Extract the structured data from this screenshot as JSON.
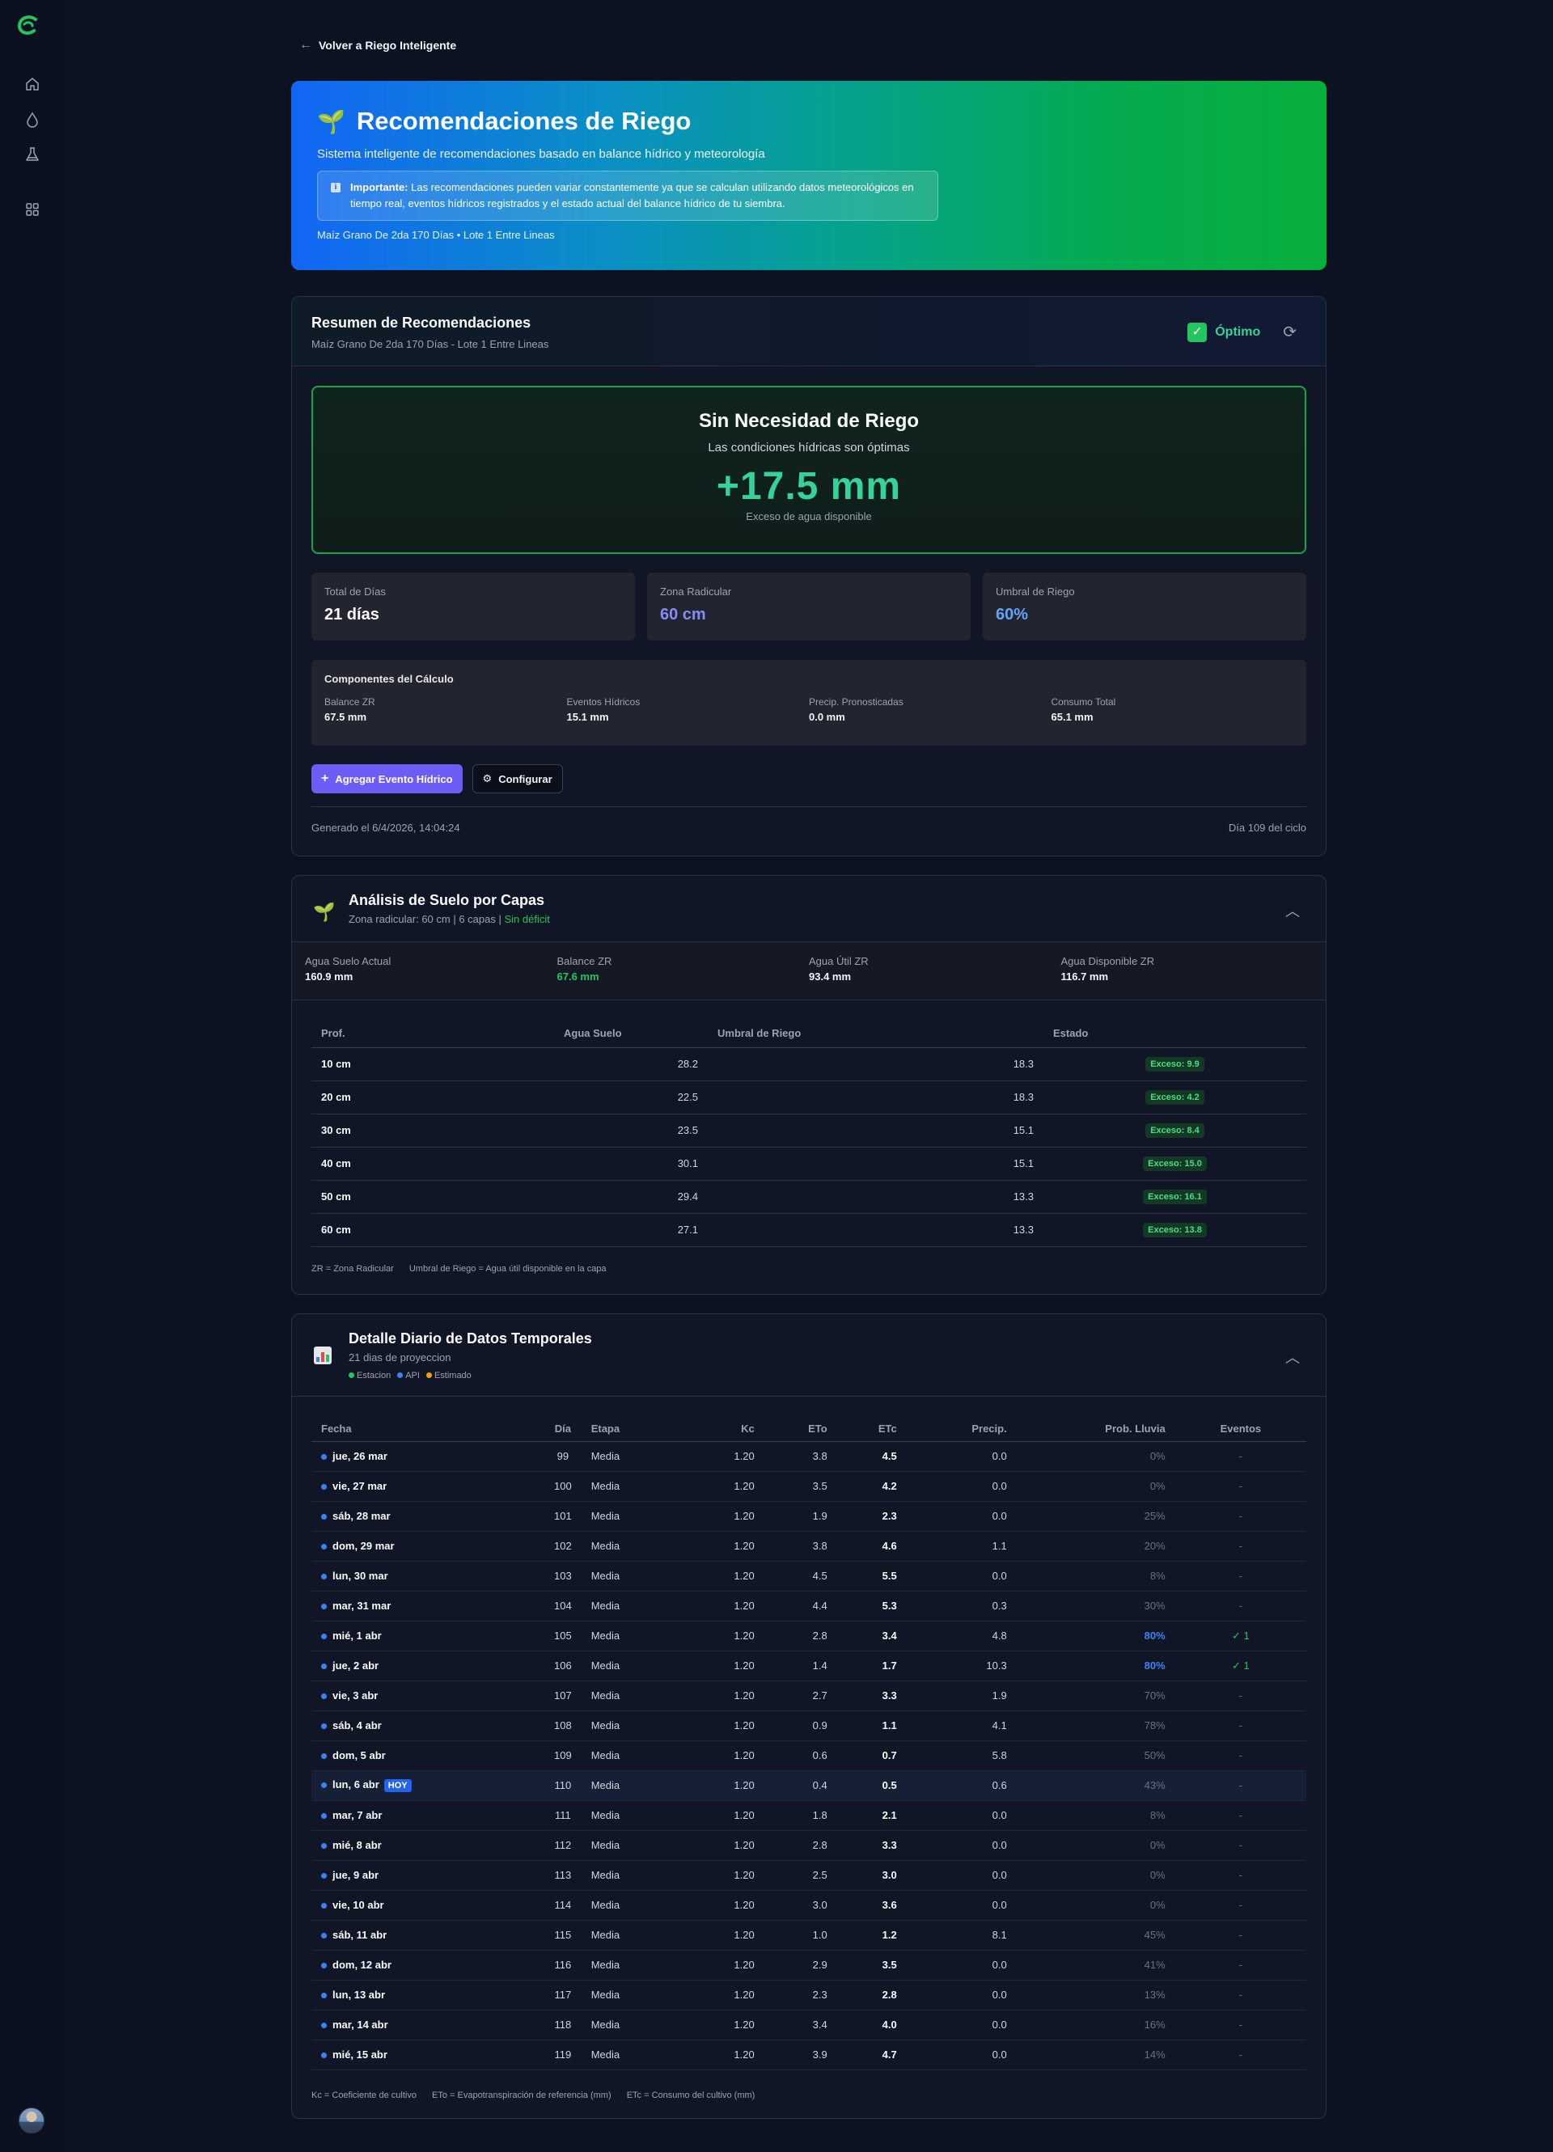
{
  "nav": {
    "back_label": "Volver a Riego Inteligente"
  },
  "hero": {
    "title": "Recomendaciones de Riego",
    "subtitle": "Sistema inteligente de recomendaciones basado en balance hídrico y meteorología",
    "note_bold": "Importante:",
    "note_text": " Las recomendaciones pueden variar constantemente ya que se calculan utilizando datos meteorológicos en tiempo real, eventos hídricos registrados y el estado actual del balance hídrico de tu siembra.",
    "crop": "Maíz Grano De 2da 170 Días • Lote 1 Entre Lineas"
  },
  "summary": {
    "title": "Resumen de Recomendaciones",
    "subtitle": "Maíz Grano De 2da 170 Días - Lote 1 Entre Lineas",
    "status": "Óptimo",
    "result_title": "Sin Necesidad de Riego",
    "result_sub": "Las condiciones hídricas son óptimas",
    "result_value": "+17.5 mm",
    "result_caption": "Exceso de agua disponible",
    "stats": [
      {
        "label": "Total de Días",
        "value": "21 días",
        "color": "#f8fafc"
      },
      {
        "label": "Zona Radicular",
        "value": "60 cm",
        "color": "#818cf8"
      },
      {
        "label": "Umbral de Riego",
        "value": "60%",
        "color": "#60a5fa"
      }
    ],
    "calc_title": "Componentes del Cálculo",
    "calc": [
      {
        "label": "Balance ZR",
        "value": "67.5 mm"
      },
      {
        "label": "Eventos Hídricos",
        "value": "15.1 mm"
      },
      {
        "label": "Precip. Pronosticadas",
        "value": "0.0 mm"
      },
      {
        "label": "Consumo Total",
        "value": "65.1 mm"
      }
    ],
    "add_button": "Agregar Evento Hídrico",
    "config_button": "Configurar",
    "generated": "Generado el 6/4/2026, 14:04:24",
    "cycle_day": "Día 109 del ciclo"
  },
  "soil": {
    "title": "Análisis de Suelo por Capas",
    "subtitle": "Zona radicular: 60 cm | 6 capas |",
    "subtitle_status": "Sin déficit",
    "metrics": [
      {
        "label": "Agua Suelo Actual",
        "value": "160.9 mm",
        "color": "#f1f5f9"
      },
      {
        "label": "Balance ZR",
        "value": "67.6 mm",
        "color": "#22c55e"
      },
      {
        "label": "Agua Útil ZR",
        "value": "93.4 mm",
        "color": "#f1f5f9"
      },
      {
        "label": "Agua Disponible ZR",
        "value": "116.7 mm",
        "color": "#f1f5f9"
      }
    ],
    "columns": [
      "Prof.",
      "Agua Suelo",
      "Umbral de Riego",
      "Estado"
    ],
    "rows": [
      {
        "prof": "10 cm",
        "agua": "28.2",
        "umbral": "18.3",
        "estado": "Exceso: 9.9"
      },
      {
        "prof": "20 cm",
        "agua": "22.5",
        "umbral": "18.3",
        "estado": "Exceso: 4.2"
      },
      {
        "prof": "30 cm",
        "agua": "23.5",
        "umbral": "15.1",
        "estado": "Exceso: 8.4"
      },
      {
        "prof": "40 cm",
        "agua": "30.1",
        "umbral": "15.1",
        "estado": "Exceso: 15.0"
      },
      {
        "prof": "50 cm",
        "agua": "29.4",
        "umbral": "13.3",
        "estado": "Exceso: 16.1"
      },
      {
        "prof": "60 cm",
        "agua": "27.1",
        "umbral": "13.3",
        "estado": "Exceso: 13.8"
      }
    ],
    "foot": [
      "ZR = Zona Radicular",
      "Umbral de Riego = Agua útil disponible en la capa"
    ]
  },
  "daily": {
    "title": "Detalle Diario de Datos Temporales",
    "subtitle": "21 dias de proyeccion",
    "legend": [
      {
        "label": "Estacion",
        "color": "#22c55e"
      },
      {
        "label": "API",
        "color": "#3b82f6"
      },
      {
        "label": "Estimado",
        "color": "#f59e0b"
      }
    ],
    "columns": [
      "Fecha",
      "Día",
      "Etapa",
      "Kc",
      "ETo",
      "ETc",
      "Precip.",
      "Prob. Lluvia",
      "Eventos"
    ],
    "today_label": "HOY",
    "rows": [
      {
        "fecha": "jue, 26 mar",
        "dia": "99",
        "etapa": "Media",
        "kc": "1.20",
        "eto": "3.8",
        "etc": "4.5",
        "precip": "0.0",
        "prob": "0%",
        "ev": "-"
      },
      {
        "fecha": "vie, 27 mar",
        "dia": "100",
        "etapa": "Media",
        "kc": "1.20",
        "eto": "3.5",
        "etc": "4.2",
        "precip": "0.0",
        "prob": "0%",
        "ev": "-"
      },
      {
        "fecha": "sáb, 28 mar",
        "dia": "101",
        "etapa": "Media",
        "kc": "1.20",
        "eto": "1.9",
        "etc": "2.3",
        "precip": "0.0",
        "prob": "25%",
        "ev": "-"
      },
      {
        "fecha": "dom, 29 mar",
        "dia": "102",
        "etapa": "Media",
        "kc": "1.20",
        "eto": "3.8",
        "etc": "4.6",
        "precip": "1.1",
        "prob": "20%",
        "ev": "-"
      },
      {
        "fecha": "lun, 30 mar",
        "dia": "103",
        "etapa": "Media",
        "kc": "1.20",
        "eto": "4.5",
        "etc": "5.5",
        "precip": "0.0",
        "prob": "8%",
        "ev": "-"
      },
      {
        "fecha": "mar, 31 mar",
        "dia": "104",
        "etapa": "Media",
        "kc": "1.20",
        "eto": "4.4",
        "etc": "5.3",
        "precip": "0.3",
        "prob": "30%",
        "ev": "-"
      },
      {
        "fecha": "mié, 1 abr",
        "dia": "105",
        "etapa": "Media",
        "kc": "1.20",
        "eto": "2.8",
        "etc": "3.4",
        "precip": "4.8",
        "prob": "80%",
        "ev": "✓ 1",
        "hi": true
      },
      {
        "fecha": "jue, 2 abr",
        "dia": "106",
        "etapa": "Media",
        "kc": "1.20",
        "eto": "1.4",
        "etc": "1.7",
        "precip": "10.3",
        "prob": "80%",
        "ev": "✓ 1",
        "hi": true
      },
      {
        "fecha": "vie, 3 abr",
        "dia": "107",
        "etapa": "Media",
        "kc": "1.20",
        "eto": "2.7",
        "etc": "3.3",
        "precip": "1.9",
        "prob": "70%",
        "ev": "-"
      },
      {
        "fecha": "sáb, 4 abr",
        "dia": "108",
        "etapa": "Media",
        "kc": "1.20",
        "eto": "0.9",
        "etc": "1.1",
        "precip": "4.1",
        "prob": "78%",
        "ev": "-"
      },
      {
        "fecha": "dom, 5 abr",
        "dia": "109",
        "etapa": "Media",
        "kc": "1.20",
        "eto": "0.6",
        "etc": "0.7",
        "precip": "5.8",
        "prob": "50%",
        "ev": "-"
      },
      {
        "fecha": "lun, 6 abr",
        "dia": "110",
        "etapa": "Media",
        "kc": "1.20",
        "eto": "0.4",
        "etc": "0.5",
        "precip": "0.6",
        "prob": "43%",
        "ev": "-",
        "today": true
      },
      {
        "fecha": "mar, 7 abr",
        "dia": "111",
        "etapa": "Media",
        "kc": "1.20",
        "eto": "1.8",
        "etc": "2.1",
        "precip": "0.0",
        "prob": "8%",
        "ev": "-"
      },
      {
        "fecha": "mié, 8 abr",
        "dia": "112",
        "etapa": "Media",
        "kc": "1.20",
        "eto": "2.8",
        "etc": "3.3",
        "precip": "0.0",
        "prob": "0%",
        "ev": "-"
      },
      {
        "fecha": "jue, 9 abr",
        "dia": "113",
        "etapa": "Media",
        "kc": "1.20",
        "eto": "2.5",
        "etc": "3.0",
        "precip": "0.0",
        "prob": "0%",
        "ev": "-"
      },
      {
        "fecha": "vie, 10 abr",
        "dia": "114",
        "etapa": "Media",
        "kc": "1.20",
        "eto": "3.0",
        "etc": "3.6",
        "precip": "0.0",
        "prob": "0%",
        "ev": "-"
      },
      {
        "fecha": "sáb, 11 abr",
        "dia": "115",
        "etapa": "Media",
        "kc": "1.20",
        "eto": "1.0",
        "etc": "1.2",
        "precip": "8.1",
        "prob": "45%",
        "ev": "-"
      },
      {
        "fecha": "dom, 12 abr",
        "dia": "116",
        "etapa": "Media",
        "kc": "1.20",
        "eto": "2.9",
        "etc": "3.5",
        "precip": "0.0",
        "prob": "41%",
        "ev": "-"
      },
      {
        "fecha": "lun, 13 abr",
        "dia": "117",
        "etapa": "Media",
        "kc": "1.20",
        "eto": "2.3",
        "etc": "2.8",
        "precip": "0.0",
        "prob": "13%",
        "ev": "-"
      },
      {
        "fecha": "mar, 14 abr",
        "dia": "118",
        "etapa": "Media",
        "kc": "1.20",
        "eto": "3.4",
        "etc": "4.0",
        "precip": "0.0",
        "prob": "16%",
        "ev": "-"
      },
      {
        "fecha": "mié, 15 abr",
        "dia": "119",
        "etapa": "Media",
        "kc": "1.20",
        "eto": "3.9",
        "etc": "4.7",
        "precip": "0.0",
        "prob": "14%",
        "ev": "-"
      }
    ],
    "foot": [
      "Kc = Coeficiente de cultivo",
      "ETo = Evapotranspiración de referencia (mm)",
      "ETc = Consumo del cultivo (mm)"
    ]
  },
  "colors": {
    "accent": "#6d5df6",
    "success": "#34d399",
    "api_dot": "#3b82f6"
  }
}
